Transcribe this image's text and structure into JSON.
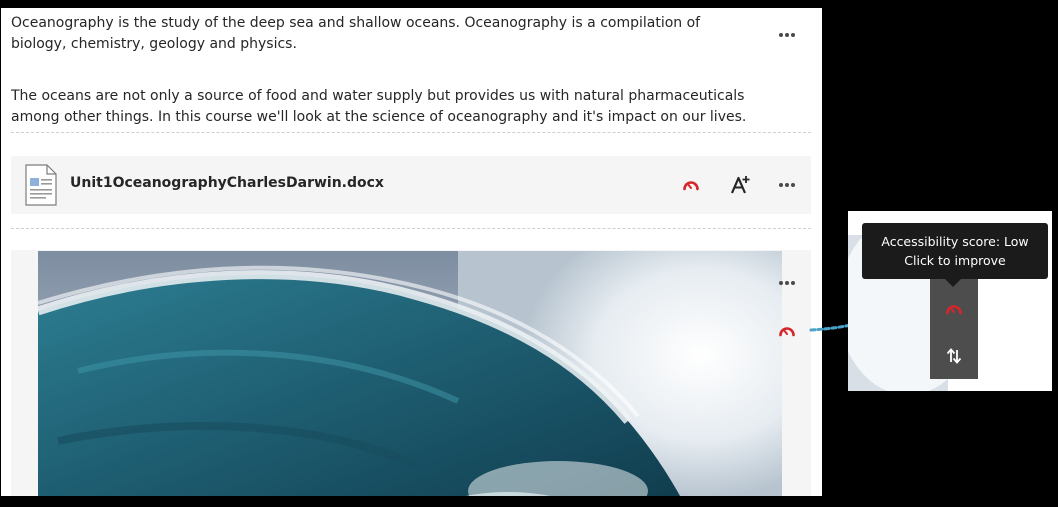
{
  "content": {
    "paragraph_1": "Oceanography is the study of the deep sea and shallow oceans. Oceanography is a compilation of biology, chemistry, geology and physics.",
    "paragraph_2": "The oceans are not only a source of food and water supply but provides us with natural pharmaceuticals among other things. In this course we'll look at the science of oceanography and it's impact on our lives."
  },
  "file": {
    "name": "Unit1OceanographyCharlesDarwin.docx",
    "icon": "document-icon"
  },
  "image": {
    "subject": "ocean-wave-image"
  },
  "tooltip": {
    "line1": "Accessibility score: Low",
    "line2": "Click to improve"
  },
  "icons": {
    "more": "more-options-icon",
    "accessibility": "accessibility-gauge-icon",
    "alternative_formats": "alternative-formats-icon",
    "reorder": "reorder-arrows-icon"
  },
  "colors": {
    "accessibility_low": "#d6262b",
    "tooltip_bg": "#1b1b1b",
    "toolbar_bg": "#4d4d4d",
    "arrow": "#4aa3c8"
  }
}
